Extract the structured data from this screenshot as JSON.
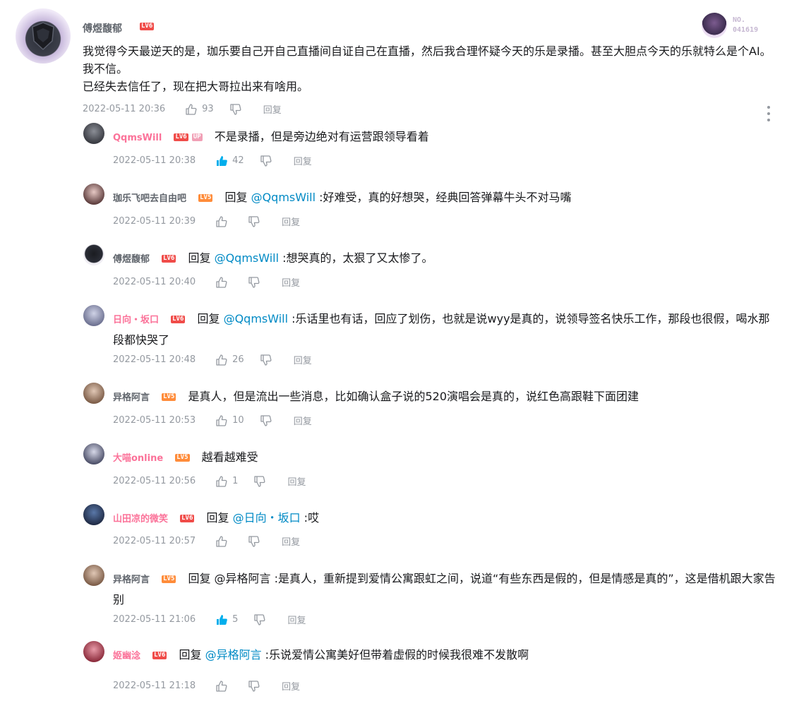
{
  "root": {
    "username": "傅煜馥郁",
    "level": "LV6",
    "fan_badge_line1": "NO.",
    "fan_badge_line2": "041619",
    "content_line1": "我觉得今天最逆天的是，珈乐要自己开自己直播间自证自己在直播，然后我合理怀疑今天的乐是录播。甚至大胆点今天的乐就特么是个AI。我不信。",
    "content_line2": "已经失去信任了，现在把大哥拉出来有啥用。",
    "time": "2022-05-11 20:36",
    "likes": "93",
    "reply_label": "回复"
  },
  "replies": [
    {
      "username": "QqmsWill",
      "level": "LV6",
      "level_color": "red",
      "badge": "UP",
      "prefix": "",
      "mention": "",
      "text": "不是录播，但是旁边绝对有运营跟领导看着",
      "time": "2022-05-11 20:38",
      "likes": "42",
      "liked": true
    },
    {
      "username": "珈乐飞吧去自由吧",
      "level": "LV5",
      "level_color": "orange",
      "prefix": "回复 ",
      "mention": "@QqmsWill",
      "text": ":好难受，真的好想哭，经典回答弹幕牛头不对马嘴",
      "time": "2022-05-11 20:39",
      "likes": ""
    },
    {
      "username": "傅煜馥郁",
      "level": "LV6",
      "level_color": "red",
      "prefix": "回复 ",
      "mention": "@QqmsWill",
      "text": ":想哭真的，太狠了又太惨了。",
      "time": "2022-05-11 20:40",
      "likes": ""
    },
    {
      "username": "日向・坂口",
      "level": "LV6",
      "level_color": "red",
      "prefix": "回复 ",
      "mention": "@QqmsWill",
      "text": ":乐话里也有话，回应了划伤，也就是说wyy是真的，说领导签名快乐工作，那段也很假，喝水那段都快哭了",
      "time": "2022-05-11 20:48",
      "likes": "26"
    },
    {
      "username": "异格阿言",
      "level": "LV5",
      "level_color": "orange",
      "prefix": "",
      "mention": "",
      "text": "是真人，但是流出一些消息，比如确认盒子说的520演唱会是真的，说红色高跟鞋下面团建",
      "time": "2022-05-11 20:53",
      "likes": "10"
    },
    {
      "username": "大喵online",
      "level": "LV5",
      "level_color": "orange",
      "prefix": "",
      "mention": "",
      "text": "越看越难受",
      "time": "2022-05-11 20:56",
      "likes": "1"
    },
    {
      "username": "山田凉的微笑",
      "level": "LV6",
      "level_color": "red",
      "prefix": "回复 ",
      "mention": "@日向・坂口",
      "text": ":哎",
      "time": "2022-05-11 20:57",
      "likes": ""
    },
    {
      "username": "异格阿言",
      "level": "LV5",
      "level_color": "orange",
      "prefix": "回复 @异格阿言 ",
      "mention": "",
      "text": ":是真人，重新提到爱情公寓跟虹之间，说道“有些东西是假的，但是情感是真的”，这是借机跟大家告别",
      "time": "2022-05-11 21:06",
      "likes": "5",
      "liked": true
    },
    {
      "username": "姬幽淰",
      "level": "LV6",
      "level_color": "red",
      "prefix": "回复 ",
      "mention": "@异格阿言",
      "text": ":乐说爱情公寓美好但带着虚假的时候我很难不发散啊",
      "time": "2022-05-11 21:18",
      "likes": ""
    }
  ],
  "reply_label": "回复"
}
